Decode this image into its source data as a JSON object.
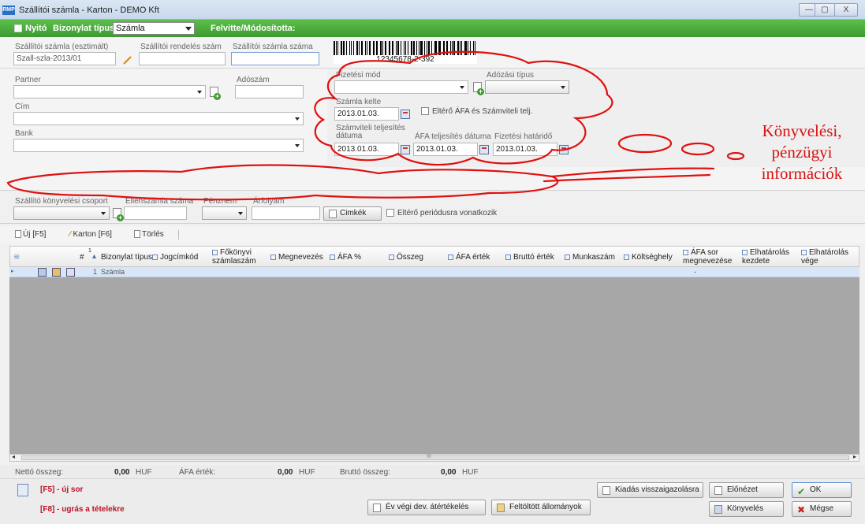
{
  "window": {
    "app_icon_text": "RMP",
    "title": "Szállítói számla - Karton  - DEMO Kft",
    "minimize": "—",
    "restore": "▢",
    "close": "X"
  },
  "greenbar": {
    "nyito_label": "Nyitó",
    "bizonylat_tipus_label": "Bizonylat típus",
    "bizonylat_tipus_value": "Számla",
    "felvitte_label": "Felvitte/Módosította:"
  },
  "header": {
    "szamla_becsult_label": "Szállítói számla (esztimált)",
    "szamla_becsult_value": "Szall-szla-2013/01",
    "rendeles_szam_label": "Szállítói rendelés szám",
    "rendeles_szam_value": "",
    "szamla_szama_label": "Szállítói számla száma",
    "szamla_szama_value": "",
    "barcode_text": "12345678-2-392"
  },
  "partner": {
    "partner_label": "Partner",
    "partner_value": "",
    "adoszam_label": "Adószám",
    "adoszam_value": "",
    "cim_label": "Cím",
    "cim_value": "",
    "bank_label": "Bank",
    "bank_value": ""
  },
  "finance": {
    "fizetesi_mod_label": "Fizetési mód",
    "fizetesi_mod_value": "",
    "adozasi_tipus_label": "Adózási típus",
    "adozasi_tipus_value": "",
    "szamla_kelte_label": "Számla kelte",
    "szamla_kelte_value": "2013.01.03.",
    "eltero_afa_label": "Eltérő ÁFA és Számviteli telj.",
    "szamviteli_telj_label_1": "Számviteli teljesítés",
    "szamviteli_telj_label_2": "dátuma",
    "szamviteli_telj_value": "2013.01.03.",
    "afa_telj_label": "ÁFA teljesítés dátuma",
    "afa_telj_value": "2013.01.03.",
    "fizetesi_hatarido_label": "Fizetési határidő",
    "fizetesi_hatarido_value": "2013.01.03."
  },
  "bank_row": {
    "konyvelesi_csoport_label": "Szállító könyvelési csoport",
    "ellenszamla_label": "Ellenszámla száma",
    "penznem_label": "Pénznem",
    "arfolyam_label": "Árfolyam",
    "arfolyam_value": "",
    "cimkek_label": "Cimkék",
    "eltero_periodus_label": "Eltérő periódusra vonatkozik"
  },
  "toolbar": {
    "new_label": "Új  [F5]",
    "karton_label": "Karton  [F6]",
    "delete_label": "Törlés"
  },
  "grid": {
    "columns": [
      "#",
      "Bizonylat típus",
      "Jogcímkód",
      "Főkönyvi számlaszám",
      "Megnevezés",
      "ÁFA %",
      "Összeg",
      "ÁFA érték",
      "Bruttó érték",
      "Munkaszám",
      "Költséghely",
      "ÁFA sor megnevezése",
      "Elhatárolás kezdete",
      "Elhatárolás vége"
    ],
    "sort_marker": "1",
    "rows": [
      {
        "num": "1",
        "bizonylat_tipus": "Számla",
        "afa_sor": "-"
      }
    ],
    "scroll_mark": "III"
  },
  "totals": {
    "netto_label": "Nettó összeg:",
    "netto_value": "0,00",
    "netto_cur": "HUF",
    "afa_label": "ÁFA érték:",
    "afa_value": "0,00",
    "afa_cur": "HUF",
    "brutto_label": "Bruttó összeg:",
    "brutto_value": "0,00",
    "brutto_cur": "HUF"
  },
  "footer": {
    "hint_f5": "[F5] - új sor",
    "hint_f8": "[F8] - ugrás a tételekre",
    "ev_vegi_label": "Év végi dev. átértékelés",
    "feltoltott_label": "Feltöltött állományok",
    "kiadas_label": "Kiadás visszaigazolásra",
    "elonezet_label": "Előnézet",
    "konyveles_label": "Könyvelés",
    "ok_label": "OK",
    "megse_label": "Mégse"
  },
  "annotation": {
    "line1": "Könyvelési,",
    "line2": "pénzügyi",
    "line3": "információk",
    "color": "#d81212"
  }
}
